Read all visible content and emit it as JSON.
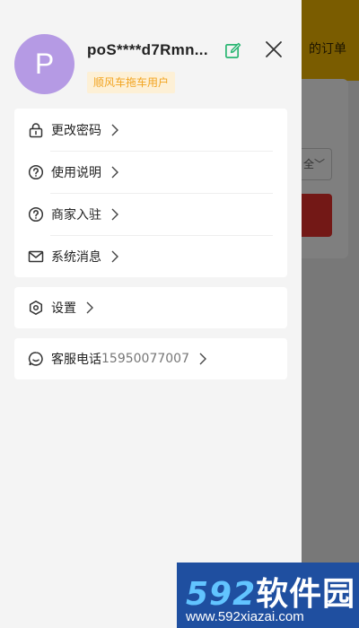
{
  "background": {
    "header_text": "的订单",
    "select_text": "全"
  },
  "profile": {
    "avatar_letter": "P",
    "username": "poS****d7Rmn...",
    "badge": "顺风车拖车用户"
  },
  "menu": {
    "items": [
      {
        "label": "更改密码",
        "icon": "lock-icon"
      },
      {
        "label": "使用说明",
        "icon": "help-circle-icon"
      },
      {
        "label": "商家入驻",
        "icon": "help-circle-icon"
      },
      {
        "label": "系统消息",
        "icon": "mail-icon"
      }
    ],
    "settings": {
      "label": "设置",
      "icon": "settings-hexagon-icon"
    },
    "service": {
      "label": "客服电话",
      "phone": "15950077007",
      "icon": "chat-bubble-icon"
    }
  },
  "watermark": {
    "num": "592",
    "text": "软件园",
    "url": "www.592xiazai.com"
  },
  "colors": {
    "avatar": "#b59ae4",
    "badge_bg": "#fdf0d6",
    "badge_text": "#f2a420",
    "edit_icon": "#2bb673",
    "header_yellow": "#f5b800",
    "watermark_bg": "#1f4fa0"
  }
}
